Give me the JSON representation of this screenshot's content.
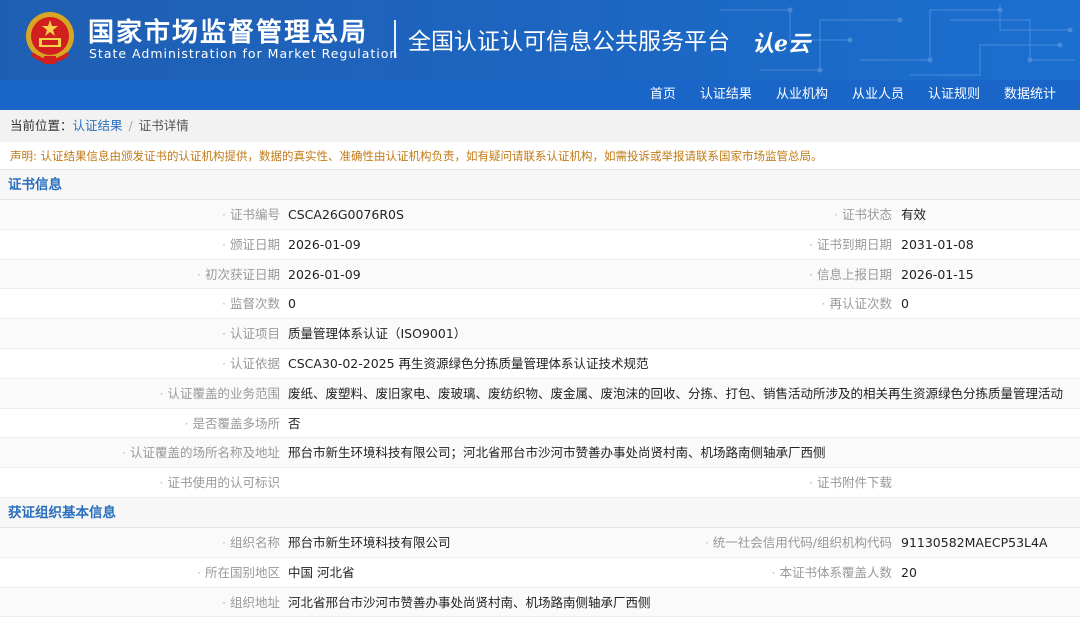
{
  "header": {
    "org_cn": "国家市场监督管理总局",
    "org_en": "State Administration  for  Market Regulation",
    "platform": "全国认证认可信息公共服务平台",
    "logo_mark": "认e云",
    "colors": {
      "header_bg": "#1d64bf",
      "nav_bg": "#1a66c8",
      "accent": "#2a6fbd",
      "notice": "#c17a14"
    }
  },
  "nav": {
    "items": [
      "首页",
      "认证结果",
      "从业机构",
      "从业人员",
      "认证规则",
      "数据统计"
    ]
  },
  "breadcrumb": {
    "prefix": "当前位置：",
    "link": "认证结果",
    "separator": "/",
    "current": "证书详情"
  },
  "notice": "声明: 认证结果信息由颁发证书的认证机构提供，数据的真实性、准确性由认证机构负责，如有疑问请联系认证机构，如需投诉或举报请联系国家市场监管总局。",
  "cert_section": {
    "title": "证书信息",
    "rows": [
      {
        "l1": "证书编号",
        "v1": "CSCA26G0076R0S",
        "l2": "证书状态",
        "v2": "有效"
      },
      {
        "l1": "颁证日期",
        "v1": "2026-01-09",
        "l2": "证书到期日期",
        "v2": "2031-01-08"
      },
      {
        "l1": "初次获证日期",
        "v1": "2026-01-09",
        "l2": "信息上报日期",
        "v2": "2026-01-15"
      },
      {
        "l1": "监督次数",
        "v1": "0",
        "l2": "再认证次数",
        "v2": "0"
      },
      {
        "l1": "认证项目",
        "v1": "质量管理体系认证（ISO9001）",
        "l2": "",
        "v2": ""
      },
      {
        "l1": "认证依据",
        "v1": "CSCA30-02-2025 再生资源绿色分拣质量管理体系认证技术规范",
        "l2": "",
        "v2": ""
      },
      {
        "l1": "认证覆盖的业务范围",
        "v1": "废纸、废塑料、废旧家电、废玻璃、废纺织物、废金属、废泡沫的回收、分拣、打包、销售活动所涉及的相关再生资源绿色分拣质量管理活动",
        "l2": "",
        "v2": ""
      },
      {
        "l1": "是否覆盖多场所",
        "v1": "否",
        "l2": "",
        "v2": ""
      },
      {
        "l1": "认证覆盖的场所名称及地址",
        "v1": "邢台市新生环境科技有限公司；河北省邢台市沙河市赞善办事处尚贤村南、机场路南侧轴承厂西侧",
        "l2": "",
        "v2": ""
      },
      {
        "l1": "证书使用的认可标识",
        "v1": "",
        "l2": "证书附件下载",
        "v2": ""
      }
    ]
  },
  "org_section": {
    "title": "获证组织基本信息",
    "rows": [
      {
        "l1": "组织名称",
        "v1": "邢台市新生环境科技有限公司",
        "l2": "统一社会信用代码/组织机构代码",
        "v2": "91130582MAECP53L4A"
      },
      {
        "l1": "所在国别地区",
        "v1": "中国 河北省",
        "l2": "本证书体系覆盖人数",
        "v2": "20"
      },
      {
        "l1": "组织地址",
        "v1": "河北省邢台市沙河市赞善办事处尚贤村南、机场路南侧轴承厂西侧",
        "l2": "",
        "v2": ""
      }
    ]
  }
}
